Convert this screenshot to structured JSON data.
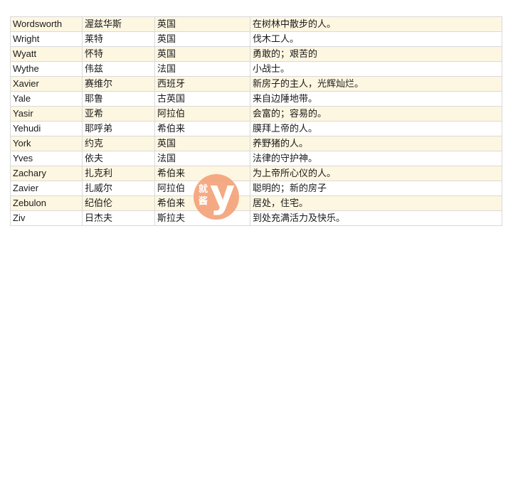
{
  "table": {
    "rows": [
      {
        "name": "Wordsworth",
        "chinese": "渥兹华斯",
        "origin": "英国",
        "meaning": "在树林中散步的人。"
      },
      {
        "name": "Wright",
        "chinese": "莱特",
        "origin": "英国",
        "meaning": "伐木工人。"
      },
      {
        "name": "Wyatt",
        "chinese": "怀特",
        "origin": "英国",
        "meaning": "勇敢的；艰苦的"
      },
      {
        "name": "Wythe",
        "chinese": "伟兹",
        "origin": "法国",
        "meaning": "小战士。"
      },
      {
        "name": "Xavier",
        "chinese": "赛维尔",
        "origin": "西班牙",
        "meaning": "新房子的主人，光辉灿烂。"
      },
      {
        "name": "Yale",
        "chinese": "耶鲁",
        "origin": "古英国",
        "meaning": "来自边陲地带。"
      },
      {
        "name": "Yasir",
        "chinese": "亚希",
        "origin": "阿拉伯",
        "meaning": "会富的；容易的。"
      },
      {
        "name": "Yehudi",
        "chinese": "耶呼弟",
        "origin": "希伯来",
        "meaning": "膜拜上帝的人。"
      },
      {
        "name": "York",
        "chinese": "约克",
        "origin": "英国",
        "meaning": "养野猪的人。"
      },
      {
        "name": "Yves",
        "chinese": "依夫",
        "origin": "法国",
        "meaning": "法律的守护神。"
      },
      {
        "name": "Zachary",
        "chinese": "扎克利",
        "origin": "希伯来",
        "meaning": "为上帝所心仪的人。"
      },
      {
        "name": "Zavier",
        "chinese": "扎威尔",
        "origin": "阿拉伯",
        "meaning": "聪明的；新的房子"
      },
      {
        "name": "Zebulon",
        "chinese": "纪伯伦",
        "origin": "希伯来",
        "meaning": "居处，住宅。"
      },
      {
        "name": "Ziv",
        "chinese": "日杰夫",
        "origin": "斯拉夫",
        "meaning": "到处充满活力及快乐。"
      }
    ]
  },
  "watermark": {
    "text_top": "就",
    "text_bottom": "酱",
    "letter": "y",
    "color": "#f4a37a"
  }
}
